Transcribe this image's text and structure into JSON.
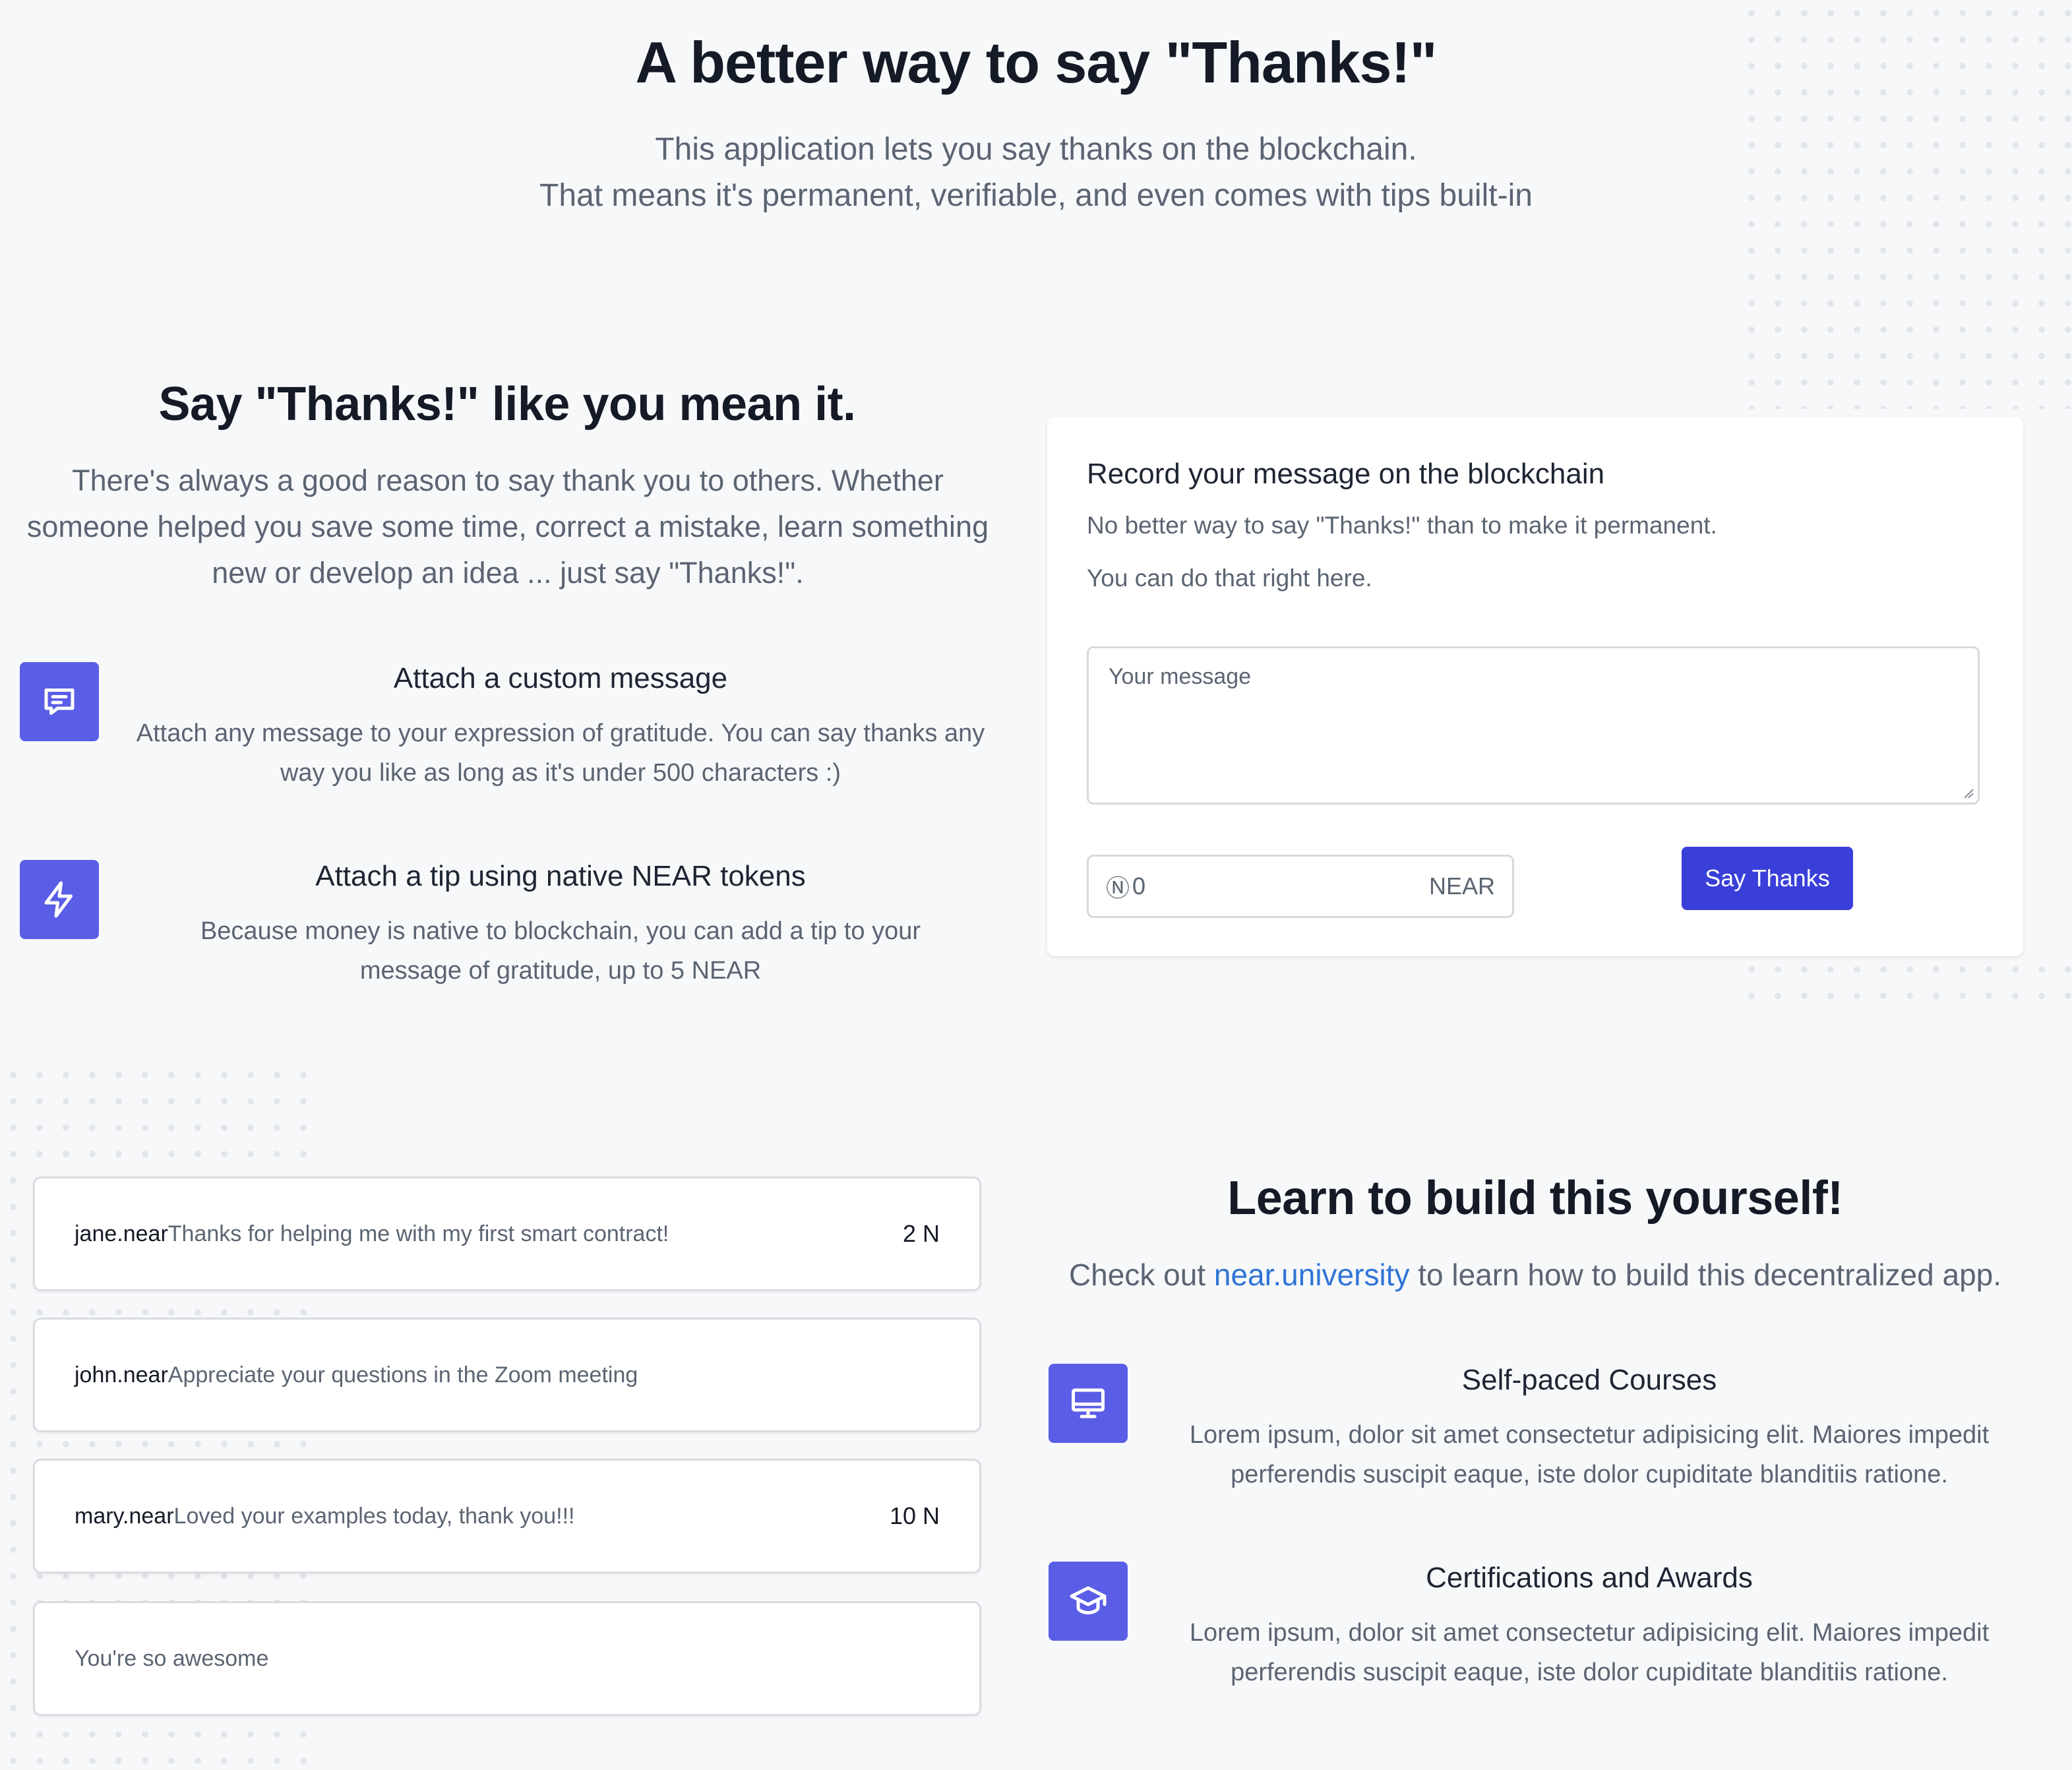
{
  "hero": {
    "title": "A better way to say \"Thanks!\"",
    "subtitle_line1": "This application lets you say thanks on the blockchain.",
    "subtitle_line2": "That means it's permanent, verifiable, and even comes with tips built-in"
  },
  "intro": {
    "title": "Say \"Thanks!\" like you mean it.",
    "description": "There's always a good reason to say thank you to others. Whether someone helped you save some time, correct a mistake, learn something new or develop an idea ... just say \"Thanks!\".",
    "features": [
      {
        "icon": "chat-icon",
        "title": "Attach a custom message",
        "text": "Attach any message to your expression of gratitude. You can say thanks any way you like as long as it's under 500 characters :)"
      },
      {
        "icon": "lightning-icon",
        "title": "Attach a tip using native NEAR tokens",
        "text": "Because money is native to blockchain, you can add a tip to your message of gratitude, up to 5 NEAR"
      }
    ]
  },
  "form": {
    "title": "Record your message on the blockchain",
    "desc1": "No better way to say \"Thanks!\" than to make it permanent.",
    "desc2": "You can do that right here.",
    "message_placeholder": "Your message",
    "tip_symbol": "Ⓝ",
    "tip_value": "0",
    "tip_unit": "NEAR",
    "submit_label": "Say Thanks"
  },
  "messages": [
    {
      "sender": "jane.near",
      "text": "Thanks for helping me with my first smart contract!",
      "amount": "2 N"
    },
    {
      "sender": "john.near",
      "text": "Appreciate your questions in the Zoom meeting",
      "amount": ""
    },
    {
      "sender": "mary.near",
      "text": "Loved your examples today, thank you!!!",
      "amount": "10 N"
    },
    {
      "sender": "",
      "text": "You're so awesome",
      "amount": ""
    }
  ],
  "learn": {
    "title": "Learn to build this yourself!",
    "text_before": "Check out ",
    "link_text": "near.university",
    "text_after": " to learn how to build this decentralized app.",
    "features": [
      {
        "icon": "monitor-icon",
        "title": "Self-paced Courses",
        "text": "Lorem ipsum, dolor sit amet consectetur adipisicing elit. Maiores impedit perferendis suscipit eaque, iste dolor cupiditate blanditiis ratione."
      },
      {
        "icon": "graduation-cap-icon",
        "title": "Certifications and Awards",
        "text": "Lorem ipsum, dolor sit amet consectetur adipisicing elit. Maiores impedit perferendis suscipit eaque, iste dolor cupiditate blanditiis ratione."
      }
    ]
  },
  "colors": {
    "accent": "#5a5ee6",
    "button": "#3a3fd9",
    "link": "#2f74d6",
    "background": "#f7f8fa"
  }
}
